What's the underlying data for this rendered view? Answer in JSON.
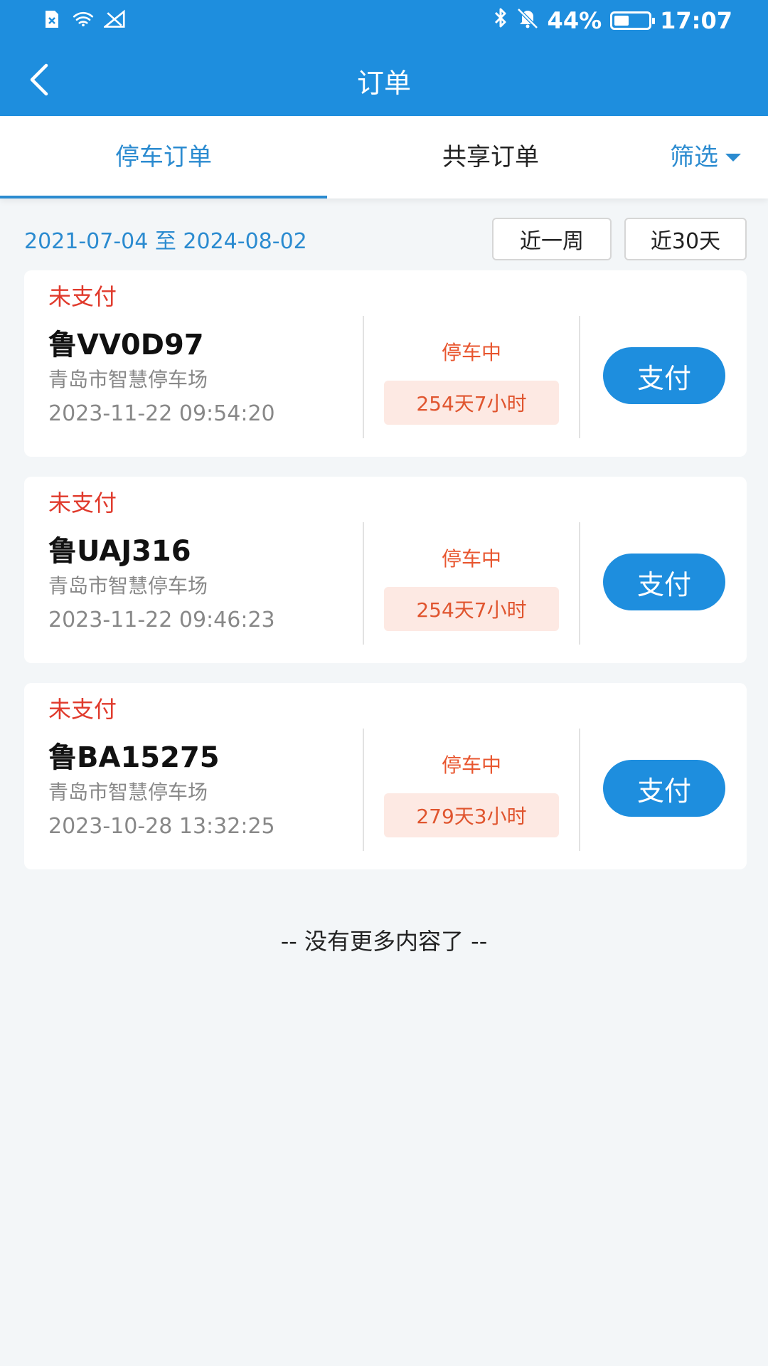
{
  "status_bar": {
    "battery": "44%",
    "battery_level": 0.44,
    "time": "17:07"
  },
  "navbar": {
    "title": "订单"
  },
  "tabs": [
    {
      "label": "停车订单",
      "active": true
    },
    {
      "label": "共享订单",
      "active": false
    }
  ],
  "filter": {
    "label": "筛选"
  },
  "date_range": {
    "text": "2021-07-04 至 2024-08-02",
    "buttons": [
      "近一周",
      "近30天"
    ]
  },
  "orders": [
    {
      "status": "未支付",
      "plate": "鲁VV0D97",
      "lot": "青岛市智慧停车场",
      "time": "2023-11-22 09:54:20",
      "state": "停车中",
      "duration": "254天7小时",
      "pay_label": "支付"
    },
    {
      "status": "未支付",
      "plate": "鲁UAJ316",
      "lot": "青岛市智慧停车场",
      "time": "2023-11-22 09:46:23",
      "state": "停车中",
      "duration": "254天7小时",
      "pay_label": "支付"
    },
    {
      "status": "未支付",
      "plate": "鲁BA15275",
      "lot": "青岛市智慧停车场",
      "time": "2023-10-28 13:32:25",
      "state": "停车中",
      "duration": "279天3小时",
      "pay_label": "支付"
    }
  ],
  "footer": {
    "text": "-- 没有更多内容了 --"
  },
  "colors": {
    "primary": "#1e8ede",
    "accent_text": "#2b8bd0",
    "unpaid": "#e03a2c",
    "parking": "#e8562f",
    "duration_bg": "#fde9e3"
  }
}
